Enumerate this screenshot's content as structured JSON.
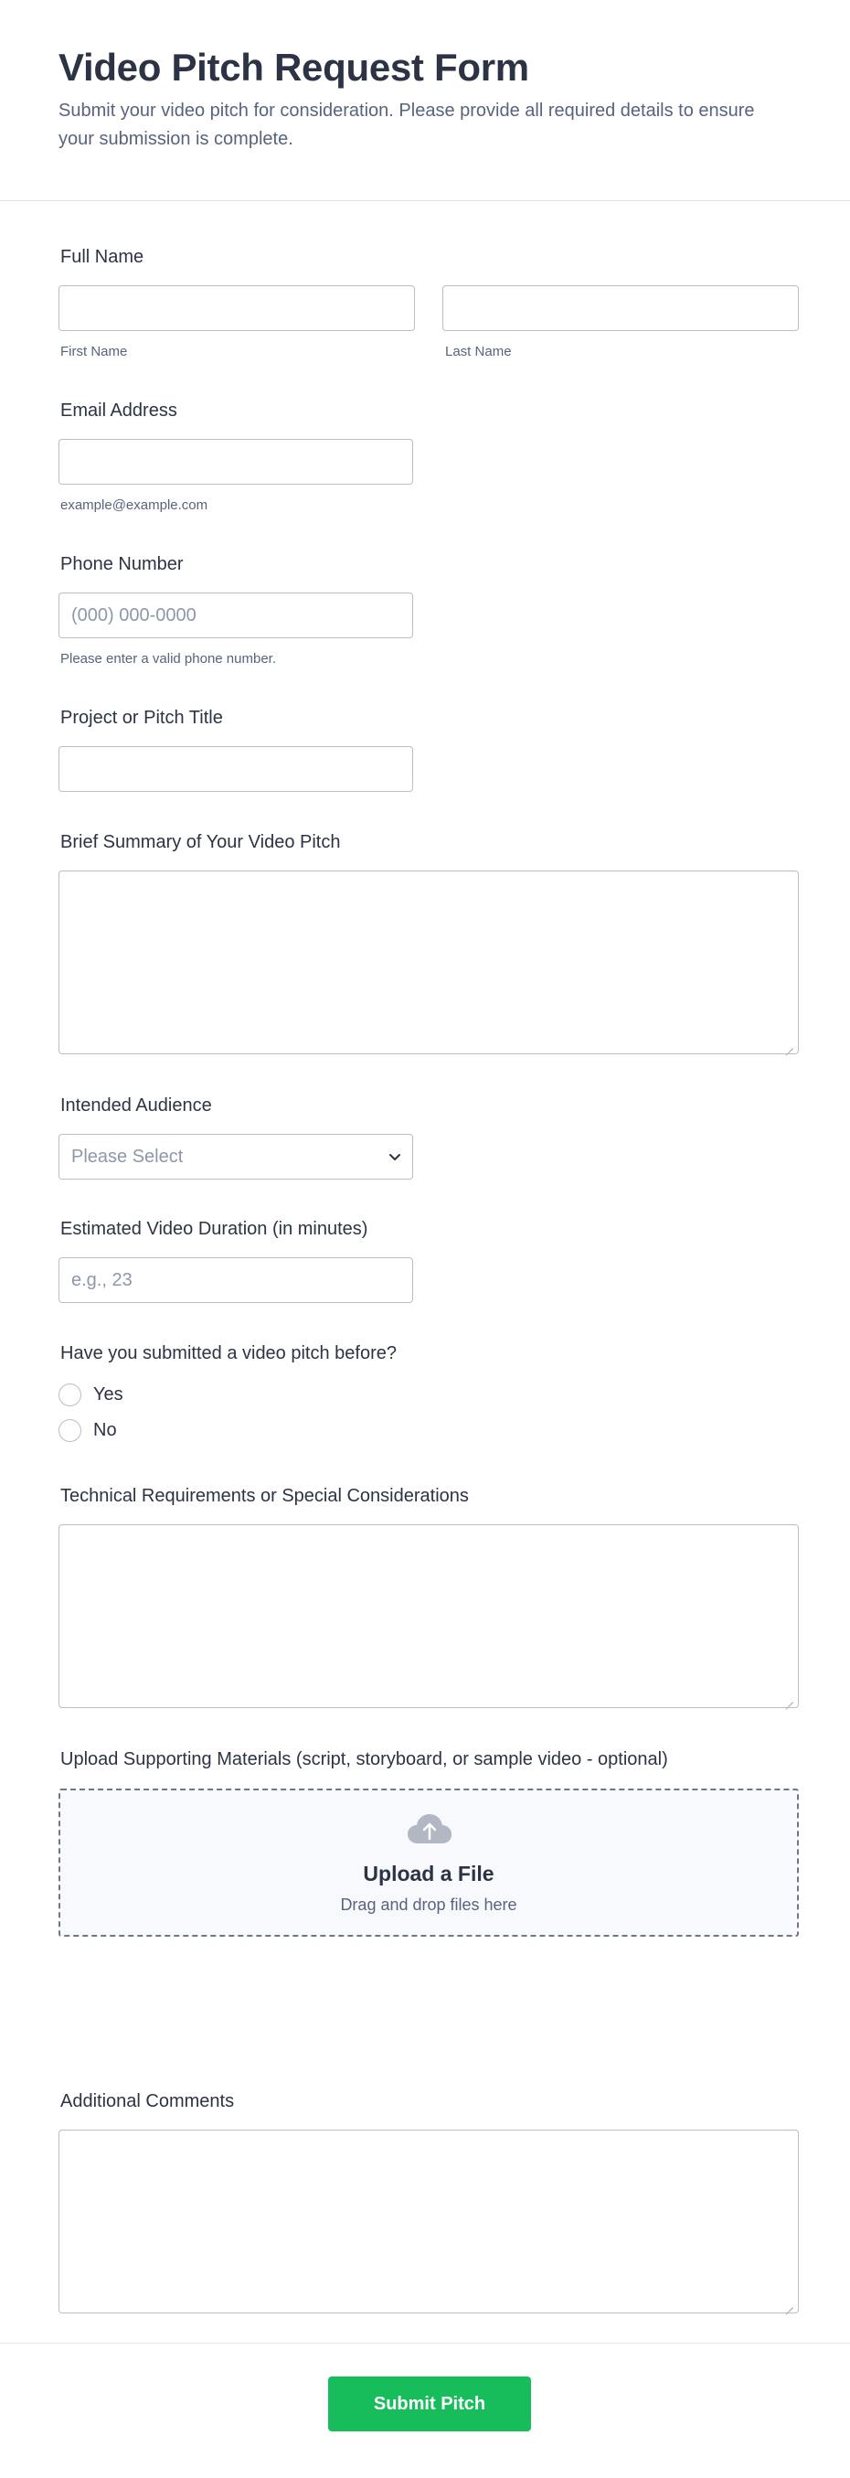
{
  "header": {
    "title": "Video Pitch Request Form",
    "subtitle": "Submit your video pitch for consideration. Please provide all required details to ensure your submission is complete."
  },
  "full_name": {
    "label": "Full Name",
    "first_value": "",
    "first_sublabel": "First Name",
    "last_value": "",
    "last_sublabel": "Last Name"
  },
  "email": {
    "label": "Email Address",
    "value": "",
    "sublabel": "example@example.com"
  },
  "phone": {
    "label": "Phone Number",
    "placeholder": "(000) 000-0000",
    "sublabel": "Please enter a valid phone number."
  },
  "project_title": {
    "label": "Project or Pitch Title",
    "value": ""
  },
  "summary": {
    "label": "Brief Summary of Your Video Pitch",
    "value": ""
  },
  "audience": {
    "label": "Intended Audience",
    "selected": "Please Select",
    "icon": "chevron-down-icon"
  },
  "duration": {
    "label": "Estimated Video Duration (in minutes)",
    "placeholder": "e.g., 23"
  },
  "submitted_before": {
    "label": "Have you submitted a video pitch before?",
    "options": [
      "Yes",
      "No"
    ]
  },
  "technical": {
    "label": "Technical Requirements or Special Considerations",
    "value": ""
  },
  "upload": {
    "label": "Upload Supporting Materials (script, storyboard, or sample video - optional)",
    "title": "Upload a File",
    "subtitle": "Drag and drop files here",
    "icon": "cloud-upload-icon"
  },
  "comments": {
    "label": "Additional Comments",
    "value": ""
  },
  "submit": {
    "label": "Submit Pitch"
  },
  "colors": {
    "accent": "#18bd5b",
    "text": "#2c3345",
    "muted": "#57647e",
    "border": "#b8bdc9",
    "upload_bg": "#f8f9fd"
  }
}
